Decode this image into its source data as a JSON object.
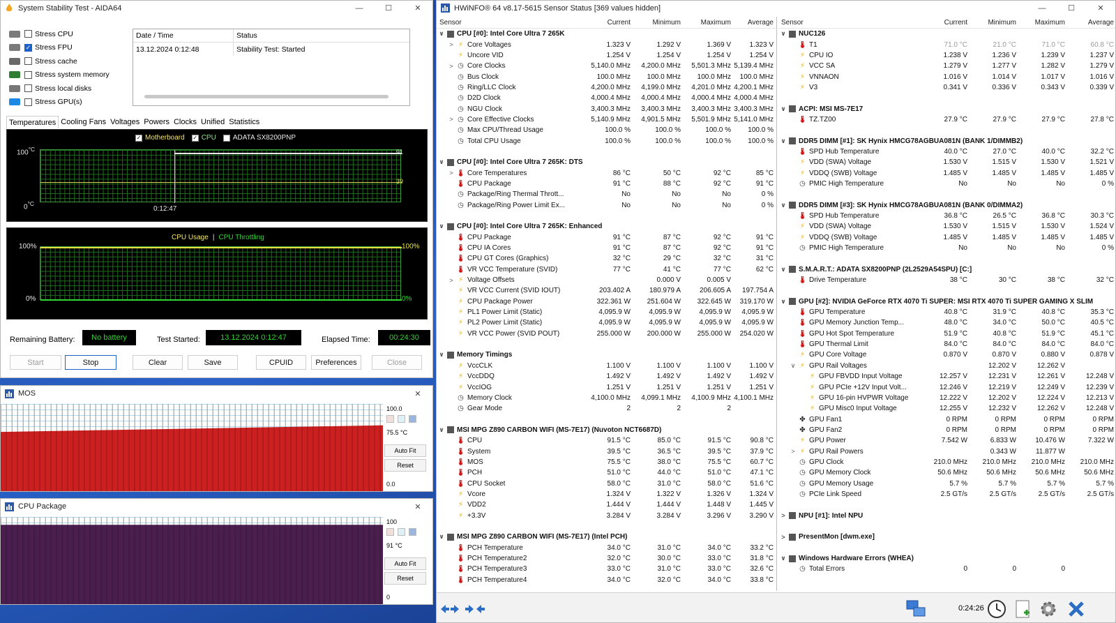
{
  "aida": {
    "title": "System Stability Test - AIDA64",
    "stress": [
      {
        "label": "Stress CPU",
        "checked": false,
        "color": "#7a7a7a"
      },
      {
        "label": "Stress FPU",
        "checked": true,
        "color": "#7a7a7a"
      },
      {
        "label": "Stress cache",
        "checked": false,
        "color": "#6a6a6a"
      },
      {
        "label": "Stress system memory",
        "checked": false,
        "color": "#2e7d32"
      },
      {
        "label": "Stress local disks",
        "checked": false,
        "color": "#777777"
      },
      {
        "label": "Stress GPU(s)",
        "checked": false,
        "color": "#1e88e5"
      }
    ],
    "log": {
      "col1": "Date / Time",
      "col2": "Status",
      "rows": [
        {
          "time": "13.12.2024 0:12:48",
          "status": "Stability Test: Started"
        }
      ]
    },
    "tabs": [
      "Temperatures",
      "Cooling Fans",
      "Voltages",
      "Powers",
      "Clocks",
      "Unified",
      "Statistics"
    ],
    "temp_graph": {
      "legend": [
        "Motherboard",
        "CPU",
        "ADATA SX8200PNP"
      ],
      "y_top": "100",
      "y_bottom": "0",
      "unit": "°C",
      "x_label": "0:12:47",
      "val1": "91",
      "val2": "39"
    },
    "usage_graph": {
      "legend1": "CPU Usage",
      "sep": "|",
      "legend2": "CPU Throttling",
      "left_top": "100%",
      "left_bottom": "0%",
      "right_top": "100%",
      "right_bottom": "0%"
    },
    "remaining_battery_label": "Remaining Battery:",
    "remaining_battery": "No battery",
    "test_started_label": "Test Started:",
    "test_started": "13.12.2024 0:12:47",
    "elapsed_label": "Elapsed Time:",
    "elapsed": "00:24:30",
    "buttons": {
      "start": "Start",
      "stop": "Stop",
      "clear": "Clear",
      "save": "Save",
      "cpuid": "CPUID",
      "preferences": "Preferences",
      "close": "Close"
    }
  },
  "mos_window": {
    "title": "MOS",
    "max": "100.0",
    "current": "75.5 °C",
    "min": "0.0",
    "autofit": "Auto Fit",
    "reset": "Reset",
    "level": 0.755,
    "color": "#cc1f1f"
  },
  "pkg_window": {
    "title": "CPU Package",
    "max": "100",
    "current": "91 °C",
    "min": "0",
    "autofit": "Auto Fit",
    "reset": "Reset",
    "level": 0.91,
    "color": "#4a1f4f"
  },
  "hwinfo": {
    "title": "HWiNFO® 64 v8.17-5615 Sensor Status [369 values hidden]",
    "headers": {
      "sensor": "Sensor",
      "current": "Current",
      "minimum": "Minimum",
      "maximum": "Maximum",
      "average": "Average"
    },
    "left": [
      {
        "t": "g",
        "n": "CPU [#0]: Intel Core Ultra 7 265K",
        "e": "∨"
      },
      {
        "i": "volt",
        "e": ">",
        "ind": 1,
        "n": "Core Voltages",
        "c": "1.323 V",
        "mi": "1.292 V",
        "ma": "1.369 V",
        "a": "1.323 V"
      },
      {
        "i": "volt",
        "n": "Uncore VID",
        "c": "1.254 V",
        "mi": "1.254 V",
        "ma": "1.254 V",
        "a": "1.254 V"
      },
      {
        "i": "clk",
        "e": ">",
        "ind": 1,
        "n": "Core Clocks",
        "c": "5,140.0 MHz",
        "mi": "4,200.0 MHz",
        "ma": "5,501.3 MHz",
        "a": "5,139.4 MHz"
      },
      {
        "i": "clk",
        "n": "Bus Clock",
        "c": "100.0 MHz",
        "mi": "100.0 MHz",
        "ma": "100.0 MHz",
        "a": "100.0 MHz"
      },
      {
        "i": "clk",
        "n": "Ring/LLC Clock",
        "c": "4,200.0 MHz",
        "mi": "4,199.0 MHz",
        "ma": "4,201.0 MHz",
        "a": "4,200.1 MHz"
      },
      {
        "i": "clk",
        "n": "D2D Clock",
        "c": "4,000.4 MHz",
        "mi": "4,000.4 MHz",
        "ma": "4,000.4 MHz",
        "a": "4,000.4 MHz"
      },
      {
        "i": "clk",
        "n": "NGU Clock",
        "c": "3,400.3 MHz",
        "mi": "3,400.3 MHz",
        "ma": "3,400.3 MHz",
        "a": "3,400.3 MHz"
      },
      {
        "i": "clk",
        "e": ">",
        "ind": 1,
        "n": "Core Effective Clocks",
        "c": "5,140.9 MHz",
        "mi": "4,901.5 MHz",
        "ma": "5,501.9 MHz",
        "a": "5,141.0 MHz"
      },
      {
        "i": "clk",
        "n": "Max CPU/Thread Usage",
        "c": "100.0 %",
        "mi": "100.0 %",
        "ma": "100.0 %",
        "a": "100.0 %"
      },
      {
        "i": "clk",
        "n": "Total CPU Usage",
        "c": "100.0 %",
        "mi": "100.0 %",
        "ma": "100.0 %",
        "a": "100.0 %"
      },
      {
        "t": "s"
      },
      {
        "t": "g",
        "n": "CPU [#0]: Intel Core Ultra 7 265K: DTS",
        "e": "∨"
      },
      {
        "i": "temp",
        "e": ">",
        "ind": 1,
        "n": "Core Temperatures",
        "c": "86 °C",
        "mi": "50 °C",
        "ma": "92 °C",
        "a": "85 °C"
      },
      {
        "i": "temp",
        "n": "CPU Package",
        "c": "91 °C",
        "mi": "88 °C",
        "ma": "92 °C",
        "a": "91 °C"
      },
      {
        "i": "clk",
        "n": "Package/Ring Thermal Thrott...",
        "c": "No",
        "mi": "No",
        "ma": "No",
        "a": "0 %"
      },
      {
        "i": "clk",
        "n": "Package/Ring Power Limit Ex...",
        "c": "No",
        "mi": "No",
        "ma": "No",
        "a": "0 %"
      },
      {
        "t": "s"
      },
      {
        "t": "g",
        "n": "CPU [#0]: Intel Core Ultra 7 265K: Enhanced",
        "e": "∨"
      },
      {
        "i": "temp",
        "n": "CPU Package",
        "c": "91 °C",
        "mi": "87 °C",
        "ma": "92 °C",
        "a": "91 °C"
      },
      {
        "i": "temp",
        "n": "CPU IA Cores",
        "c": "91 °C",
        "mi": "87 °C",
        "ma": "92 °C",
        "a": "91 °C"
      },
      {
        "i": "temp",
        "n": "CPU GT Cores (Graphics)",
        "c": "32 °C",
        "mi": "29 °C",
        "ma": "32 °C",
        "a": "31 °C"
      },
      {
        "i": "temp",
        "n": "VR VCC Temperature (SVID)",
        "c": "77 °C",
        "mi": "41 °C",
        "ma": "77 °C",
        "a": "62 °C"
      },
      {
        "i": "volt",
        "e": ">",
        "ind": 1,
        "n": "Voltage Offsets",
        "c": "",
        "mi": "0.000 V",
        "ma": "0.005 V",
        "a": ""
      },
      {
        "i": "pow",
        "n": "VR VCC Current (SVID IOUT)",
        "c": "203.402 A",
        "mi": "180.979 A",
        "ma": "206.605 A",
        "a": "197.754 A"
      },
      {
        "i": "pow",
        "n": "CPU Package Power",
        "c": "322.361 W",
        "mi": "251.604 W",
        "ma": "322.645 W",
        "a": "319.170 W"
      },
      {
        "i": "pow",
        "n": "PL1 Power Limit (Static)",
        "c": "4,095.9 W",
        "mi": "4,095.9 W",
        "ma": "4,095.9 W",
        "a": "4,095.9 W"
      },
      {
        "i": "pow",
        "n": "PL2 Power Limit (Static)",
        "c": "4,095.9 W",
        "mi": "4,095.9 W",
        "ma": "4,095.9 W",
        "a": "4,095.9 W"
      },
      {
        "i": "pow",
        "n": "VR VCC Power (SVID POUT)",
        "c": "255.000 W",
        "mi": "200.000 W",
        "ma": "255.000 W",
        "a": "254.020 W"
      },
      {
        "t": "s"
      },
      {
        "t": "g",
        "n": "Memory Timings",
        "e": "∨"
      },
      {
        "i": "volt",
        "n": "VccCLK",
        "c": "1.100 V",
        "mi": "1.100 V",
        "ma": "1.100 V",
        "a": "1.100 V"
      },
      {
        "i": "volt",
        "n": "VccDDQ",
        "c": "1.492 V",
        "mi": "1.492 V",
        "ma": "1.492 V",
        "a": "1.492 V"
      },
      {
        "i": "volt",
        "n": "VccIOG",
        "c": "1.251 V",
        "mi": "1.251 V",
        "ma": "1.251 V",
        "a": "1.251 V"
      },
      {
        "i": "clk",
        "n": "Memory Clock",
        "c": "4,100.0 MHz",
        "mi": "4,099.1 MHz",
        "ma": "4,100.9 MHz",
        "a": "4,100.1 MHz"
      },
      {
        "i": "clk",
        "n": "Gear Mode",
        "c": "2",
        "mi": "2",
        "ma": "2",
        "a": ""
      },
      {
        "t": "s"
      },
      {
        "t": "g",
        "n": "MSI MPG Z890 CARBON WIFI (MS-7E17) (Nuvoton NCT6687D)",
        "e": "∨"
      },
      {
        "i": "temp",
        "n": "CPU",
        "c": "91.5 °C",
        "mi": "85.0 °C",
        "ma": "91.5 °C",
        "a": "90.8 °C"
      },
      {
        "i": "temp",
        "n": "System",
        "c": "39.5 °C",
        "mi": "36.5 °C",
        "ma": "39.5 °C",
        "a": "37.9 °C"
      },
      {
        "i": "temp",
        "n": "MOS",
        "c": "75.5 °C",
        "mi": "38.0 °C",
        "ma": "75.5 °C",
        "a": "60.7 °C"
      },
      {
        "i": "temp",
        "n": "PCH",
        "c": "51.0 °C",
        "mi": "44.0 °C",
        "ma": "51.0 °C",
        "a": "47.1 °C"
      },
      {
        "i": "temp",
        "n": "CPU Socket",
        "c": "58.0 °C",
        "mi": "31.0 °C",
        "ma": "58.0 °C",
        "a": "51.6 °C"
      },
      {
        "i": "volt",
        "n": "Vcore",
        "c": "1.324 V",
        "mi": "1.322 V",
        "ma": "1.326 V",
        "a": "1.324 V"
      },
      {
        "i": "volt",
        "n": "VDD2",
        "c": "1.444 V",
        "mi": "1.444 V",
        "ma": "1.448 V",
        "a": "1.445 V"
      },
      {
        "i": "volt",
        "n": "+3.3V",
        "c": "3.284 V",
        "mi": "3.284 V",
        "ma": "3.296 V",
        "a": "3.290 V"
      },
      {
        "t": "s"
      },
      {
        "t": "g",
        "n": "MSI MPG Z890 CARBON WIFI (MS-7E17) (Intel PCH)",
        "e": "∨"
      },
      {
        "i": "temp",
        "n": "PCH Temperature",
        "c": "34.0 °C",
        "mi": "31.0 °C",
        "ma": "34.0 °C",
        "a": "33.2 °C"
      },
      {
        "i": "temp",
        "n": "PCH Temperature2",
        "c": "32.0 °C",
        "mi": "30.0 °C",
        "ma": "33.0 °C",
        "a": "31.8 °C"
      },
      {
        "i": "temp",
        "n": "PCH Temperature3",
        "c": "33.0 °C",
        "mi": "31.0 °C",
        "ma": "33.0 °C",
        "a": "32.6 °C"
      },
      {
        "i": "temp",
        "n": "PCH Temperature4",
        "c": "34.0 °C",
        "mi": "32.0 °C",
        "ma": "34.0 °C",
        "a": "33.8 °C"
      }
    ],
    "right": [
      {
        "t": "g",
        "n": "NUC126",
        "e": "∨"
      },
      {
        "i": "temp",
        "n": "T1",
        "c": "71.0 °C",
        "mi": "21.0 °C",
        "ma": "71.0 °C",
        "a": "60.8 °C",
        "muted": true
      },
      {
        "i": "volt",
        "n": "CPU IO",
        "c": "1.238 V",
        "mi": "1.236 V",
        "ma": "1.239 V",
        "a": "1.237 V"
      },
      {
        "i": "volt",
        "n": "VCC SA",
        "c": "1.279 V",
        "mi": "1.277 V",
        "ma": "1.282 V",
        "a": "1.279 V"
      },
      {
        "i": "volt",
        "n": "VNNAON",
        "c": "1.016 V",
        "mi": "1.014 V",
        "ma": "1.017 V",
        "a": "1.016 V"
      },
      {
        "i": "volt",
        "n": "V3",
        "c": "0.341 V",
        "mi": "0.336 V",
        "ma": "0.343 V",
        "a": "0.339 V"
      },
      {
        "t": "s"
      },
      {
        "t": "g",
        "n": "ACPI: MSI MS-7E17",
        "e": "∨"
      },
      {
        "i": "temp",
        "n": "TZ.TZ00",
        "c": "27.9 °C",
        "mi": "27.9 °C",
        "ma": "27.9 °C",
        "a": "27.8 °C"
      },
      {
        "t": "s"
      },
      {
        "t": "g",
        "n": "DDR5 DIMM [#1]: SK Hynix HMCG78AGBUA081N (BANK 1/DIMMB2)",
        "e": "∨"
      },
      {
        "i": "temp",
        "n": "SPD Hub Temperature",
        "c": "40.0 °C",
        "mi": "27.0 °C",
        "ma": "40.0 °C",
        "a": "32.2 °C"
      },
      {
        "i": "volt",
        "n": "VDD (SWA) Voltage",
        "c": "1.530 V",
        "mi": "1.515 V",
        "ma": "1.530 V",
        "a": "1.521 V"
      },
      {
        "i": "volt",
        "n": "VDDQ (SWB) Voltage",
        "c": "1.485 V",
        "mi": "1.485 V",
        "ma": "1.485 V",
        "a": "1.485 V"
      },
      {
        "i": "clk",
        "n": "PMIC High Temperature",
        "c": "No",
        "mi": "No",
        "ma": "No",
        "a": "0 %"
      },
      {
        "t": "s"
      },
      {
        "t": "g",
        "n": "DDR5 DIMM [#3]: SK Hynix HMCG78AGBUA081N (BANK 0/DIMMA2)",
        "e": "∨"
      },
      {
        "i": "temp",
        "n": "SPD Hub Temperature",
        "c": "36.8 °C",
        "mi": "26.5 °C",
        "ma": "36.8 °C",
        "a": "30.3 °C"
      },
      {
        "i": "volt",
        "n": "VDD (SWA) Voltage",
        "c": "1.530 V",
        "mi": "1.515 V",
        "ma": "1.530 V",
        "a": "1.524 V"
      },
      {
        "i": "volt",
        "n": "VDDQ (SWB) Voltage",
        "c": "1.485 V",
        "mi": "1.485 V",
        "ma": "1.485 V",
        "a": "1.485 V"
      },
      {
        "i": "clk",
        "n": "PMIC High Temperature",
        "c": "No",
        "mi": "No",
        "ma": "No",
        "a": "0 %"
      },
      {
        "t": "s"
      },
      {
        "t": "g",
        "n": "S.M.A.R.T.: ADATA SX8200PNP (2L2529A54SPU) [C:]",
        "e": "∨"
      },
      {
        "i": "temp",
        "n": "Drive Temperature",
        "c": "38 °C",
        "mi": "30 °C",
        "ma": "38 °C",
        "a": "32 °C"
      },
      {
        "t": "s"
      },
      {
        "t": "g",
        "n": "GPU [#2]: NVIDIA GeForce RTX 4070 Ti SUPER: MSI RTX 4070 Ti SUPER GAMING X SLIM",
        "e": "∨"
      },
      {
        "i": "temp",
        "n": "GPU Temperature",
        "c": "40.8 °C",
        "mi": "31.9 °C",
        "ma": "40.8 °C",
        "a": "35.3 °C"
      },
      {
        "i": "temp",
        "n": "GPU Memory Junction Temp...",
        "c": "48.0 °C",
        "mi": "34.0 °C",
        "ma": "50.0 °C",
        "a": "40.5 °C"
      },
      {
        "i": "temp",
        "n": "GPU Hot Spot Temperature",
        "c": "51.9 °C",
        "mi": "40.8 °C",
        "ma": "51.9 °C",
        "a": "45.1 °C"
      },
      {
        "i": "temp",
        "n": "GPU Thermal Limit",
        "c": "84.0 °C",
        "mi": "84.0 °C",
        "ma": "84.0 °C",
        "a": "84.0 °C"
      },
      {
        "i": "volt",
        "n": "GPU Core Voltage",
        "c": "0.870 V",
        "mi": "0.870 V",
        "ma": "0.880 V",
        "a": "0.878 V"
      },
      {
        "i": "volt",
        "e": "∨",
        "ind": 1,
        "n": "GPU Rail Voltages",
        "c": "",
        "mi": "12.202 V",
        "ma": "12.262 V",
        "a": ""
      },
      {
        "i": "volt",
        "ind": 2,
        "n": "GPU FBVDD Input Voltage",
        "c": "12.257 V",
        "mi": "12.231 V",
        "ma": "12.261 V",
        "a": "12.248 V"
      },
      {
        "i": "volt",
        "ind": 2,
        "n": "GPU PCIe +12V Input Volt...",
        "c": "12.246 V",
        "mi": "12.219 V",
        "ma": "12.249 V",
        "a": "12.239 V"
      },
      {
        "i": "volt",
        "ind": 2,
        "n": "GPU 16-pin HVPWR Voltage",
        "c": "12.222 V",
        "mi": "12.202 V",
        "ma": "12.224 V",
        "a": "12.213 V"
      },
      {
        "i": "volt",
        "ind": 2,
        "n": "GPU Misc0 Input Voltage",
        "c": "12.255 V",
        "mi": "12.232 V",
        "ma": "12.262 V",
        "a": "12.248 V"
      },
      {
        "i": "fan",
        "n": "GPU Fan1",
        "c": "0 RPM",
        "mi": "0 RPM",
        "ma": "0 RPM",
        "a": "0 RPM"
      },
      {
        "i": "fan",
        "n": "GPU Fan2",
        "c": "0 RPM",
        "mi": "0 RPM",
        "ma": "0 RPM",
        "a": "0 RPM"
      },
      {
        "i": "pow",
        "n": "GPU Power",
        "c": "7.542 W",
        "mi": "6.833 W",
        "ma": "10.476 W",
        "a": "7.322 W"
      },
      {
        "i": "pow",
        "e": ">",
        "ind": 1,
        "n": "GPU Rail Powers",
        "c": "",
        "mi": "0.343 W",
        "ma": "11.877 W",
        "a": ""
      },
      {
        "i": "clk",
        "n": "GPU Clock",
        "c": "210.0 MHz",
        "mi": "210.0 MHz",
        "ma": "210.0 MHz",
        "a": "210.0 MHz"
      },
      {
        "i": "clk",
        "n": "GPU Memory Clock",
        "c": "50.6 MHz",
        "mi": "50.6 MHz",
        "ma": "50.6 MHz",
        "a": "50.6 MHz"
      },
      {
        "i": "clk",
        "n": "GPU Memory Usage",
        "c": "5.7 %",
        "mi": "5.7 %",
        "ma": "5.7 %",
        "a": "5.7 %"
      },
      {
        "i": "clk",
        "n": "PCIe Link Speed",
        "c": "2.5 GT/s",
        "mi": "2.5 GT/s",
        "ma": "2.5 GT/s",
        "a": "2.5 GT/s"
      },
      {
        "t": "s"
      },
      {
        "t": "g",
        "n": "NPU [#1]: Intel NPU",
        "e": ">"
      },
      {
        "t": "s"
      },
      {
        "t": "g",
        "n": "PresentMon [dwm.exe]",
        "e": ">"
      },
      {
        "t": "s"
      },
      {
        "t": "g",
        "n": "Windows Hardware Errors (WHEA)",
        "e": "∨"
      },
      {
        "i": "clk",
        "n": "Total Errors",
        "c": "0",
        "mi": "0",
        "ma": "0",
        "a": ""
      }
    ],
    "clock": "0:24:26"
  }
}
